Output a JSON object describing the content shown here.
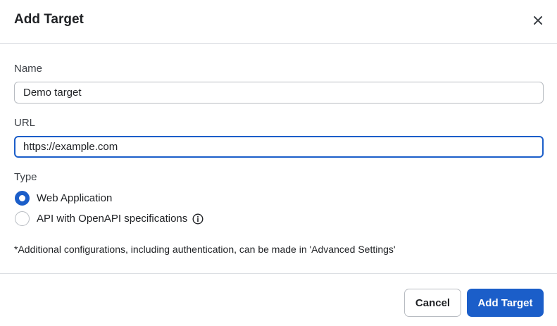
{
  "dialog": {
    "title": "Add Target",
    "close_icon": "close-icon"
  },
  "form": {
    "name": {
      "label": "Name",
      "value": "Demo target"
    },
    "url": {
      "label": "URL",
      "value": "https://example.com"
    },
    "type": {
      "label": "Type",
      "options": [
        {
          "label": "Web Application",
          "selected": true
        },
        {
          "label": "API with OpenAPI specifications",
          "selected": false,
          "icon": "info-icon"
        }
      ]
    },
    "note": "*Additional configurations, including authentication, can be made in 'Advanced Settings'"
  },
  "footer": {
    "cancel_label": "Cancel",
    "submit_label": "Add Target"
  },
  "colors": {
    "accent": "#1b5ec9",
    "border": "#b8bcc2",
    "divider": "#dcdfe3",
    "text": "#1f2124"
  }
}
